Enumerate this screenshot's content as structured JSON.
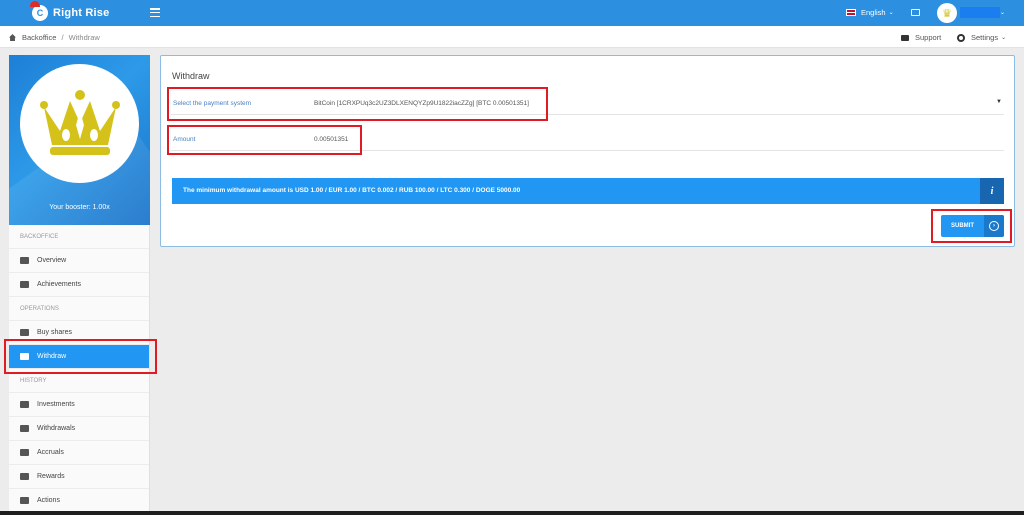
{
  "header": {
    "brand": "Right Rise",
    "language": "English"
  },
  "breadcrumb": {
    "root": "Backoffice",
    "separator": "/",
    "current": "Withdraw"
  },
  "toolbar": {
    "support_label": "Support",
    "settings_label": "Settings"
  },
  "sidebar": {
    "booster_text": "Your booster: 1.00x",
    "sections": [
      {
        "title": "BACKOFFICE",
        "items": [
          "Overview",
          "Achievements"
        ]
      },
      {
        "title": "OPERATIONS",
        "items": [
          "Buy shares",
          "Withdraw"
        ]
      },
      {
        "title": "HISTORY",
        "items": [
          "Investments",
          "Withdrawals",
          "Accruals",
          "Rewards",
          "Actions"
        ]
      }
    ],
    "active_item": "Withdraw"
  },
  "form": {
    "title": "Withdraw",
    "payment_label": "Select the payment system",
    "payment_value": "BitCoin [1CRXPUq3c2UZ3DLXENQYZp9U1822iacZZg] [BTC 0.00501351]",
    "amount_label": "Amount",
    "amount_value": "0.00501351",
    "info_text": "The minimum withdrawal amount is USD 1.00 / EUR 1.00 / BTC 0.002 / RUB 100.00 / LTC 0.300 / DOGE 5000.00",
    "info_icon": "i",
    "submit_label": "SUBMIT"
  },
  "colors": {
    "primary": "#2196f3",
    "highlight": "#e01b24",
    "crown": "#d4c21b"
  }
}
